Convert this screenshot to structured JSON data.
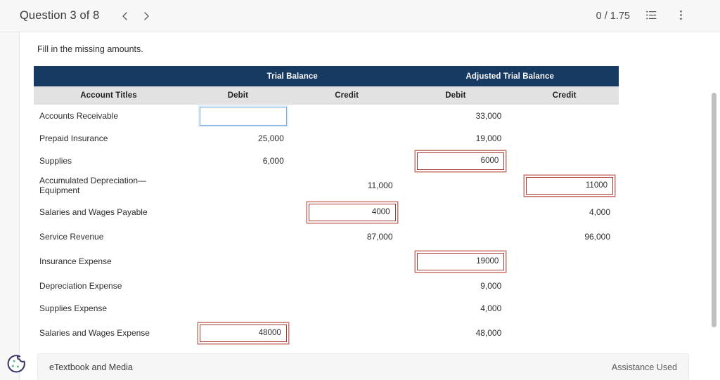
{
  "topbar": {
    "question_title": "Question 3 of 8",
    "prev_label": "Previous question",
    "next_label": "Next question",
    "score": "0 / 1.75",
    "list_icon": "list-icon",
    "menu_icon": "kebab-menu-icon"
  },
  "content": {
    "prompt": "Fill in the missing amounts."
  },
  "table": {
    "group_headers": [
      "",
      "Trial Balance",
      "",
      "Adjusted Trial Balance",
      ""
    ],
    "group_spans": [
      1,
      2,
      2
    ],
    "group_labels": {
      "blank": "",
      "trial_balance": "Trial Balance",
      "adjusted_trial_balance": "Adjusted Trial Balance"
    },
    "column_headers": [
      "Account Titles",
      "Debit",
      "Credit",
      "Debit",
      "Credit"
    ],
    "rows": [
      {
        "title": "Accounts Receivable",
        "tb_debit": {
          "type": "input",
          "value": "",
          "state": "focused"
        },
        "tb_credit": {
          "type": "empty",
          "value": ""
        },
        "atb_debit": {
          "type": "text",
          "value": "33,000"
        },
        "atb_credit": {
          "type": "empty",
          "value": ""
        }
      },
      {
        "title": "Prepaid Insurance",
        "tb_debit": {
          "type": "text",
          "value": "25,000"
        },
        "tb_credit": {
          "type": "empty",
          "value": ""
        },
        "atb_debit": {
          "type": "text",
          "value": "19,000"
        },
        "atb_credit": {
          "type": "empty",
          "value": ""
        }
      },
      {
        "title": "Supplies",
        "tb_debit": {
          "type": "text",
          "value": "6,000"
        },
        "tb_credit": {
          "type": "empty",
          "value": ""
        },
        "atb_debit": {
          "type": "input",
          "value": "6000",
          "state": "marked"
        },
        "atb_credit": {
          "type": "empty",
          "value": ""
        }
      },
      {
        "title": "Accumulated Depreciation—Equipment",
        "tb_debit": {
          "type": "empty",
          "value": ""
        },
        "tb_credit": {
          "type": "text",
          "value": "11,000"
        },
        "atb_debit": {
          "type": "empty",
          "value": ""
        },
        "atb_credit": {
          "type": "input",
          "value": "11000",
          "state": "marked"
        }
      },
      {
        "title": "Salaries and Wages Payable",
        "tb_debit": {
          "type": "empty",
          "value": ""
        },
        "tb_credit": {
          "type": "input",
          "value": "4000",
          "state": "marked"
        },
        "atb_debit": {
          "type": "empty",
          "value": ""
        },
        "atb_credit": {
          "type": "text",
          "value": "4,000"
        }
      },
      {
        "title": "Service Revenue",
        "tb_debit": {
          "type": "empty",
          "value": ""
        },
        "tb_credit": {
          "type": "text",
          "value": "87,000"
        },
        "atb_debit": {
          "type": "empty",
          "value": ""
        },
        "atb_credit": {
          "type": "text",
          "value": "96,000"
        }
      },
      {
        "title": "Insurance Expense",
        "tb_debit": {
          "type": "empty",
          "value": ""
        },
        "tb_credit": {
          "type": "empty",
          "value": ""
        },
        "atb_debit": {
          "type": "input",
          "value": "19000",
          "state": "marked"
        },
        "atb_credit": {
          "type": "empty",
          "value": ""
        }
      },
      {
        "title": "Depreciation Expense",
        "tb_debit": {
          "type": "empty",
          "value": ""
        },
        "tb_credit": {
          "type": "empty",
          "value": ""
        },
        "atb_debit": {
          "type": "text",
          "value": "9,000"
        },
        "atb_credit": {
          "type": "empty",
          "value": ""
        }
      },
      {
        "title": "Supplies Expense",
        "tb_debit": {
          "type": "empty",
          "value": ""
        },
        "tb_credit": {
          "type": "empty",
          "value": ""
        },
        "atb_debit": {
          "type": "text",
          "value": "4,000"
        },
        "atb_credit": {
          "type": "empty",
          "value": ""
        }
      },
      {
        "title": "Salaries and Wages Expense",
        "tb_debit": {
          "type": "input",
          "value": "48000",
          "state": "marked"
        },
        "tb_credit": {
          "type": "empty",
          "value": ""
        },
        "atb_debit": {
          "type": "text",
          "value": "48,000"
        },
        "atb_credit": {
          "type": "empty",
          "value": ""
        }
      }
    ]
  },
  "footer": {
    "etextbook_label": "eTextbook and Media",
    "assistance_label": "Assistance Used"
  },
  "cookie_widget": {
    "icon": "cookie-icon"
  },
  "colors": {
    "header_navy": "#173a63",
    "subheader_gray": "#e2e2e2",
    "marked_border": "#a83c32",
    "marked_outer": "#c8766d",
    "focus_border": "#7aaede",
    "cookie_outline": "#3b3a6b",
    "cookie_dot": "#5fc08a"
  }
}
